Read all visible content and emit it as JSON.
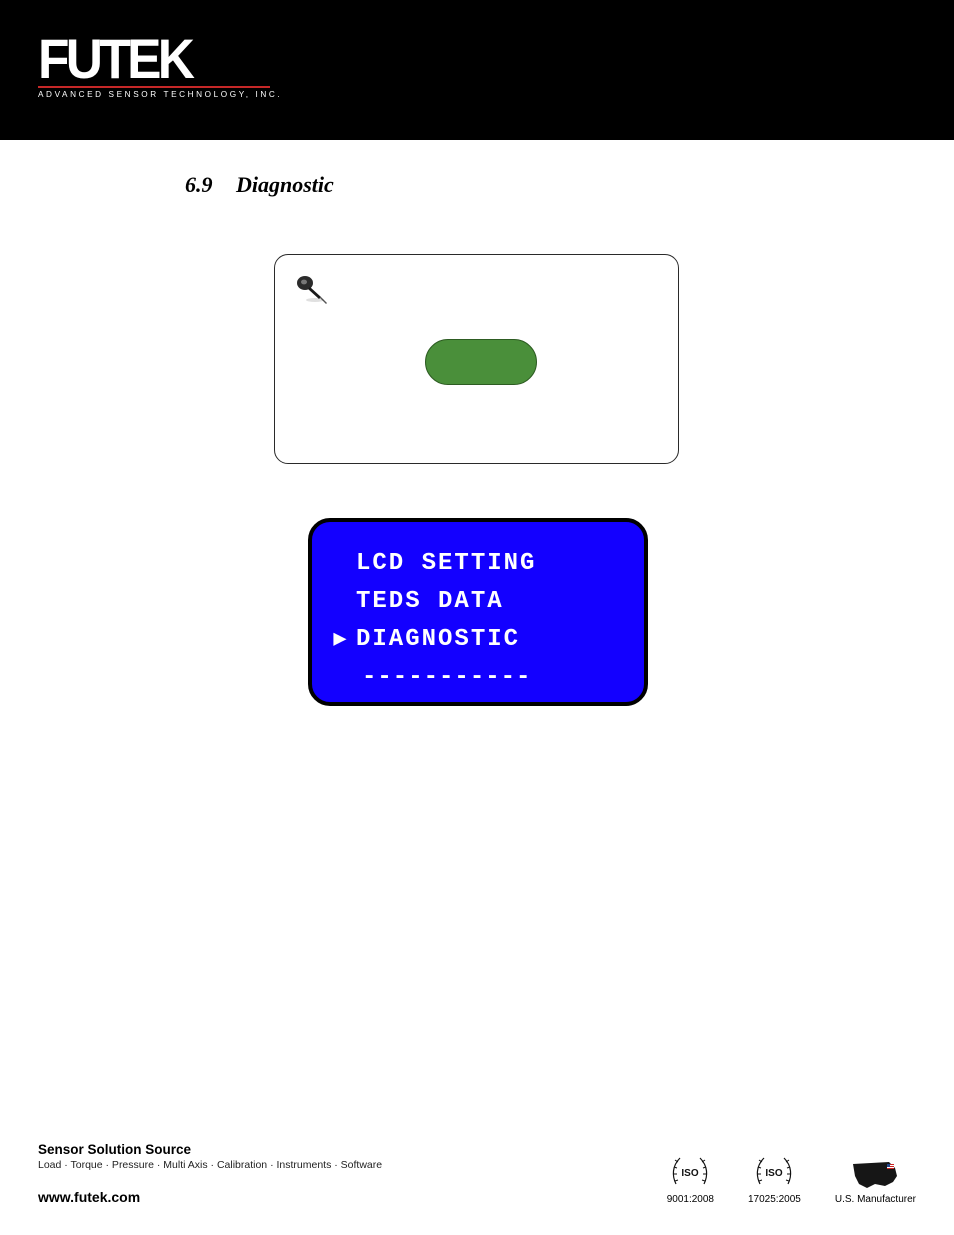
{
  "header": {
    "brand": "FUTEK",
    "tagline": "ADVANCED SENSOR TECHNOLOGY, INC."
  },
  "section": {
    "number": "6.9",
    "title": "Diagnostic"
  },
  "lcd": {
    "line1": "LCD SETTING",
    "line2": "TEDS DATA",
    "line3": "DIAGNOSTIC",
    "line4": "-----------",
    "marker": "▶"
  },
  "footer": {
    "title": "Sensor Solution Source",
    "subtitle": "Load · Torque · Pressure · Multi Axis · Calibration · Instruments · Software",
    "url": "www.futek.com",
    "badges": {
      "iso9001": "9001:2008",
      "iso17025": "17025:2005",
      "usmfg": "U.S. Manufacturer"
    }
  }
}
